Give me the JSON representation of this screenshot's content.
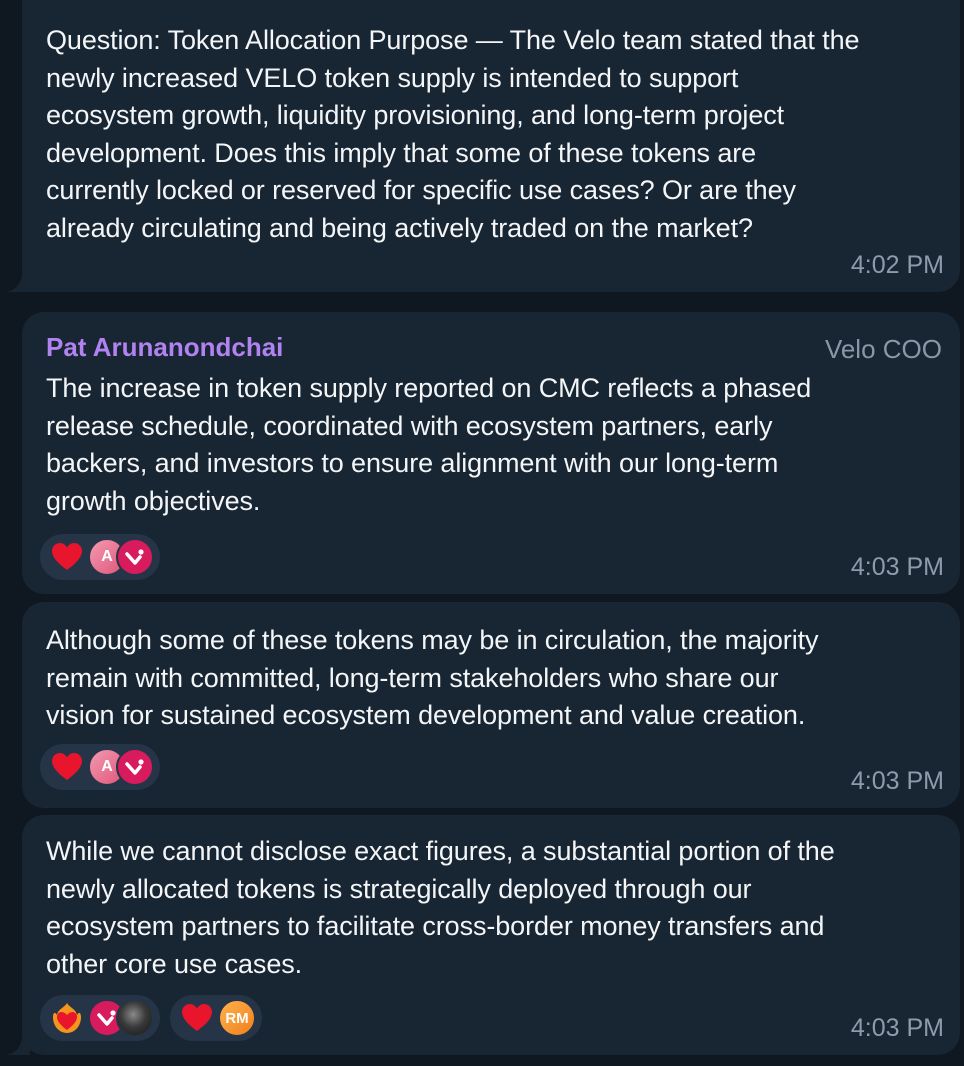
{
  "messages": [
    {
      "text": "Question: Token Allocation Purpose — The Velo team stated that the\nnewly increased VELO token supply is intended to support\necosystem growth, liquidity provisioning, and long-term project\ndevelopment. Does this imply that some of these tokens are\ncurrently locked or reserved for specific use cases? Or are they\nalready circulating and being actively traded on the market?",
      "time": "4:02 PM"
    },
    {
      "sender": "Pat Arunanondchai",
      "role": "Velo COO",
      "text": "The increase in token supply reported on CMC reflects a phased\nrelease schedule, coordinated with ecosystem partners, early\nbackers, and investors to ensure alignment with our long-term\ngrowth objectives.",
      "time": "4:03 PM",
      "reactions": [
        {
          "emoji_icon": "red-heart",
          "avatars": [
            {
              "initial": "A"
            },
            {
              "icon": "velo-logo"
            }
          ]
        }
      ]
    },
    {
      "text": "Although some of these tokens may be in circulation, the majority\nremain with committed, long-term stakeholders who share our\nvision for sustained ecosystem development and value creation.",
      "time": "4:03 PM",
      "reactions": [
        {
          "emoji_icon": "red-heart",
          "avatars": [
            {
              "initial": "A"
            },
            {
              "icon": "velo-logo"
            }
          ]
        }
      ]
    },
    {
      "text": "While we cannot disclose exact figures, a substantial portion of the\nnewly allocated tokens is strategically deployed through our\necosystem partners to facilitate cross-border money transfers and\nother core use cases.",
      "time": "4:03 PM",
      "reactions": [
        {
          "emoji_icon": "heart-on-fire",
          "avatars": [
            {
              "icon": "velo-logo"
            },
            {
              "icon": "dark-photo"
            }
          ]
        },
        {
          "emoji_icon": "red-heart",
          "avatars": [
            {
              "initial": "RM"
            }
          ]
        }
      ]
    }
  ],
  "colors": {
    "background": "#0f1720",
    "bubble": "#182533",
    "reaction_pill": "#253547",
    "sender_name": "#b083f0",
    "text": "#f3f5f7",
    "meta": "#8e9baa",
    "heart": "#e8152c",
    "velo": "#d81b5c"
  }
}
